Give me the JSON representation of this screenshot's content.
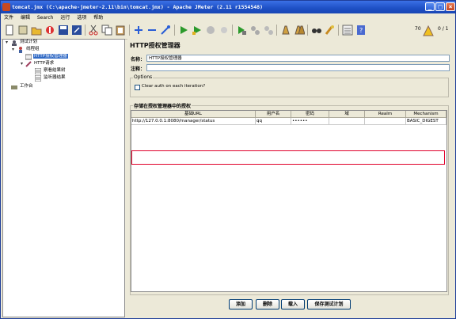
{
  "window": {
    "title": "tomcat.jmx (C:\\apache-jmeter-2.11\\bin\\tomcat.jmx) - Apache JMeter (2.11 r1554548)"
  },
  "menu": [
    "文件",
    "编辑",
    "Search",
    "运行",
    "选项",
    "帮助"
  ],
  "toolbar": {
    "warning_count": "70",
    "threads": "0 / 1"
  },
  "tree": {
    "test_plan": "测试计划",
    "thread_group": "线程组",
    "auth_manager": "HTTP授权管理器",
    "http_request": "HTTP请求",
    "view_results_tree": "察看结果树",
    "view_results_table": "监听器结果",
    "workbench": "工作台"
  },
  "panel": {
    "title": "HTTP授权管理器",
    "name_label": "名称：",
    "name_value": "HTTP授权管理器",
    "comment_label": "注释：",
    "options_title": "Options",
    "clear_auth_label": "Clear auth on each iteration?",
    "stored_title": "存储在授权管理器中的授权"
  },
  "table": {
    "headers": [
      "基础URL",
      "用户名",
      "密码",
      "域",
      "Realm",
      "Mechanism"
    ],
    "rows": [
      [
        "http://127.0.0.1:8080/manager/status",
        "qq",
        "••••••",
        "",
        "",
        "BASIC_DIGEST"
      ]
    ]
  },
  "buttons": {
    "add": "添加",
    "delete": "删除",
    "load": "载入",
    "save": "保存测试计划"
  }
}
